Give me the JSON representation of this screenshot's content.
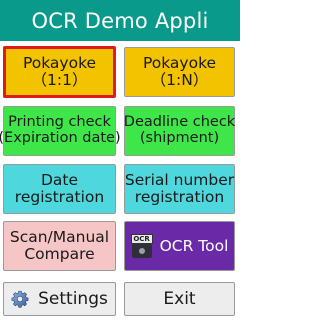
{
  "app": {
    "title": "OCR Demo Appli"
  },
  "buttons": {
    "pokayoke_1_1": {
      "line1": "Pokayoke",
      "line2": "（1:1）"
    },
    "pokayoke_1_n": {
      "line1": "Pokayoke",
      "line2": "（1:N）"
    },
    "printing_check": {
      "line1": "Printing check",
      "line2": "(Expiration date)"
    },
    "deadline_check": {
      "line1": "Deadline check",
      "line2": "(shipment)"
    },
    "date_registration": {
      "line1": "Date",
      "line2": "registration"
    },
    "serial_registration": {
      "line1": "Serial number",
      "line2": "registration"
    },
    "scan_compare": {
      "line1": "Scan/Manual",
      "line2": "Compare"
    },
    "ocr_tool": {
      "label": "OCR Tool",
      "icon": "camera-ocr-icon",
      "icon_text": "OCR"
    },
    "settings": {
      "label": "Settings",
      "icon": "gear-icon"
    },
    "exit": {
      "label": "Exit"
    }
  },
  "colors": {
    "titlebar": "#0a9a8c",
    "yellow": "#f4c300",
    "green": "#3ee64a",
    "cyan": "#4ed8de",
    "pink": "#f6c6c6",
    "purple": "#6a2aa8",
    "selected_border": "#e01a1a"
  }
}
